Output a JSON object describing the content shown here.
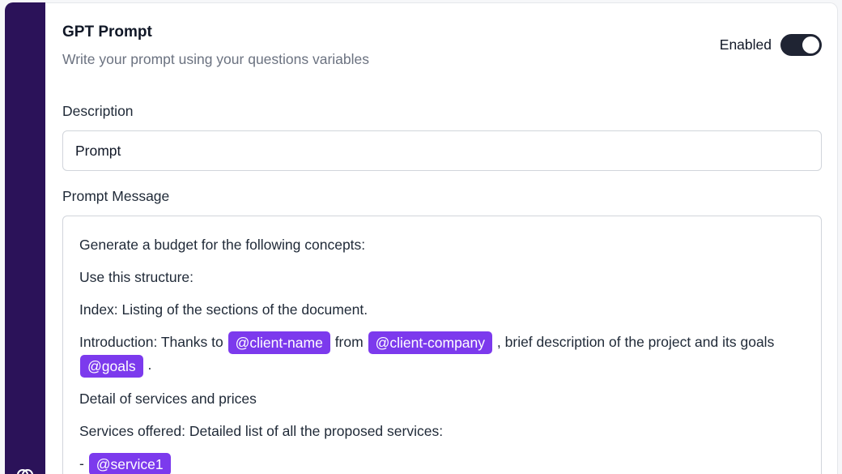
{
  "section": {
    "title": "GPT Prompt",
    "subtitle": "Write your prompt using your questions variables",
    "toggle_label": "Enabled",
    "toggle_on": true
  },
  "description": {
    "label": "Description",
    "value": "Prompt"
  },
  "prompt": {
    "label": "Prompt Message",
    "line1": "Generate a budget for the following concepts:",
    "line2": "Use this structure:",
    "line3": "Index: Listing of the sections of the document.",
    "intro_prefix": "Introduction: Thanks to",
    "var_client_name": "@client-name",
    "intro_from": "from",
    "var_client_company": "@client-company",
    "intro_suffix": ", brief description of the project and its goals",
    "var_goals": "@goals",
    "intro_end": ".",
    "line5": "Detail of services and prices",
    "line6": "Services offered: Detailed list of all the proposed services:",
    "bullet_dash": "-",
    "var_service1": "@service1"
  },
  "colors": {
    "sidebar": "#2b1259",
    "chip": "#7c3aed",
    "toggle": "#1f2433"
  }
}
